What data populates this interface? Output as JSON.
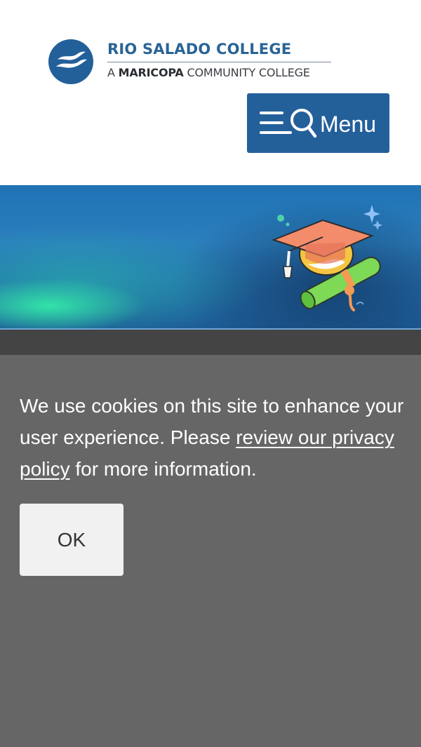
{
  "header": {
    "logo": {
      "name": "RIO SALADO COLLEGE",
      "subtitle_prefix": "A ",
      "subtitle_strong": "MARICOPA",
      "subtitle_rest": " COMMUNITY COLLEGE",
      "icon": "wave-mark-icon"
    },
    "menu_button": {
      "label": "Menu",
      "icon": "menu-search-icon"
    }
  },
  "hero": {
    "illustration": "graduation-cap-diploma-illustration"
  },
  "cookie_banner": {
    "text_before": "We use cookies on this site to enhance your user experience. Please ",
    "link_text": "review our privacy policy",
    "text_after": " for more information.",
    "ok_label": "OK"
  },
  "colors": {
    "brand_blue": "#23609a",
    "banner_gray": "#666666",
    "strip_gray": "#444444",
    "ok_button_bg": "#f1f1f1"
  }
}
